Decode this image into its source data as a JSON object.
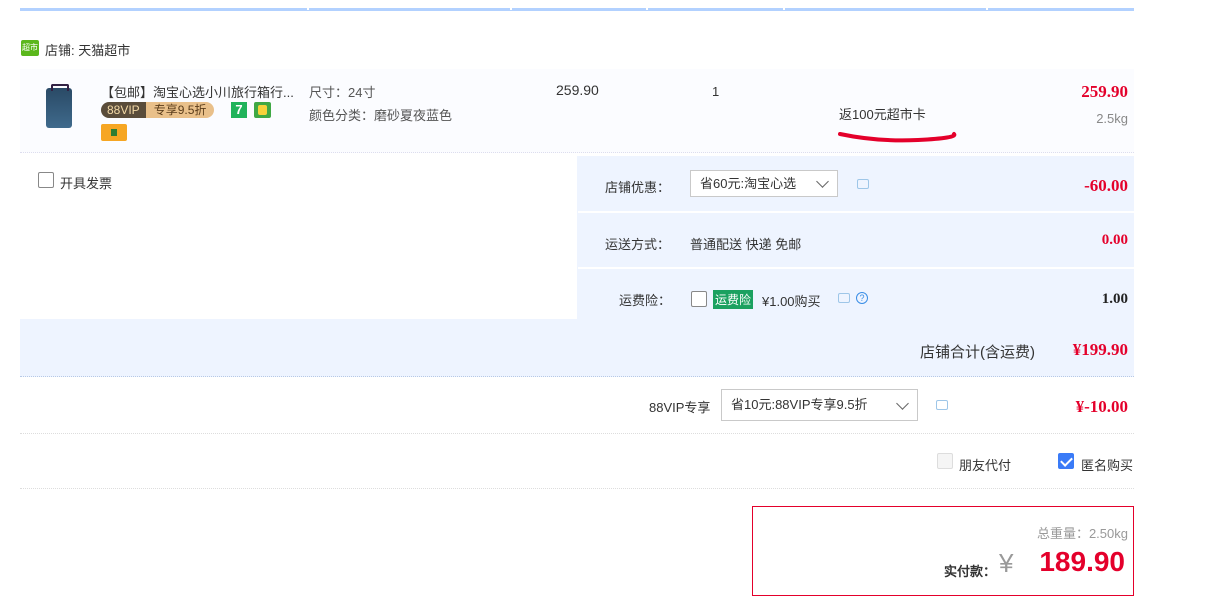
{
  "shop": {
    "icon": "超市",
    "label": "店铺: 天猫超市"
  },
  "item": {
    "title": "【包邮】淘宝心选小川旅行箱行...",
    "vip_left": "88VIP",
    "vip_right": "专享9.5折",
    "seven_badge": "7",
    "spec_size": "尺寸：24寸",
    "spec_color": "颜色分类：磨砂夏夜蓝色",
    "unit_price": "259.90",
    "quantity": "1",
    "promo": "返100元超市卡",
    "subtotal": "259.90",
    "weight": "2.5kg"
  },
  "invoice": {
    "label": "开具发票"
  },
  "shop_discount": {
    "label": "店铺优惠：",
    "selected": "省60元:淘宝心选",
    "amount": "-60.00"
  },
  "shipping": {
    "label": "运送方式：",
    "value": "普通配送 快递 免邮",
    "amount": "0.00"
  },
  "insurance": {
    "label": "运费险：",
    "tag": "运费险",
    "price": "¥1.00购买",
    "help": "?",
    "amount": "1.00"
  },
  "shop_total": {
    "label": "店铺合计(含运费)",
    "amount": "¥199.90"
  },
  "vip_discount": {
    "label": "88VIP专享",
    "selected": "省10元:88VIP专享9.5折",
    "amount": "¥-10.00"
  },
  "options": {
    "friend_pay": "朋友代付",
    "anonymous": "匿名购买"
  },
  "summary": {
    "weight": "总重量：2.50kg",
    "pay_label": "实付款：",
    "currency": "¥",
    "amount": "189.90"
  },
  "colors": {
    "accent_red": "#e4002b",
    "panel_blue": "#eef4ff",
    "check_blue": "#3a7bf7"
  }
}
